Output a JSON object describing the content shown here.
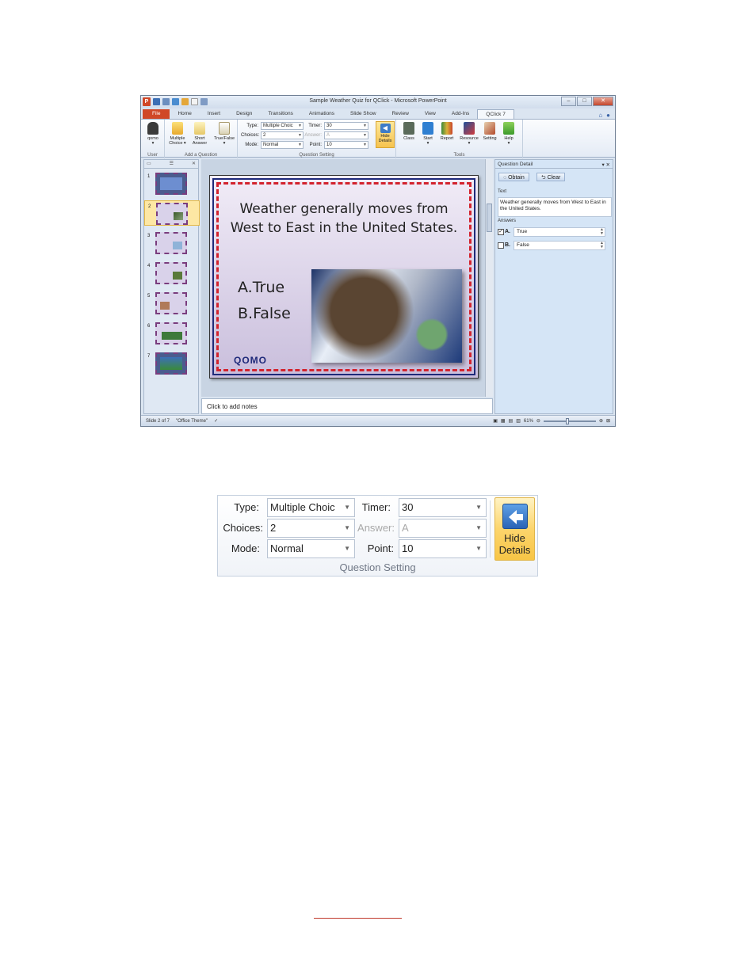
{
  "window": {
    "title": "Sample Weather Quiz for QClick - Microsoft PowerPoint",
    "logo_letter": "P",
    "controls": [
      "–",
      "□",
      "✕"
    ]
  },
  "tabs": [
    "File",
    "Home",
    "Insert",
    "Design",
    "Transitions",
    "Animations",
    "Slide Show",
    "Review",
    "View",
    "Add-Ins",
    "QClick 7"
  ],
  "active_tab": "QClick 7",
  "ribbon": {
    "user_group": {
      "label": "User",
      "button": "qomo"
    },
    "add_question_group": {
      "label": "Add a Question",
      "buttons": [
        {
          "line1": "Multiple",
          "line2": "Choice ▾"
        },
        {
          "line1": "Short",
          "line2": "Answer"
        },
        {
          "line1": "True/False",
          "line2": "▾"
        }
      ]
    },
    "question_setting_group": {
      "label": "Question Setting",
      "type_label": "Type:",
      "type_value": "Multiple Choic",
      "choices_label": "Choices:",
      "choices_value": "2",
      "mode_label": "Mode:",
      "mode_value": "Normal",
      "timer_label": "Timer:",
      "timer_value": "30",
      "answer_label": "Answer:",
      "answer_value": "A",
      "point_label": "Point:",
      "point_value": "10",
      "hide_line1": "Hide",
      "hide_line2": "Details"
    },
    "tools_group": {
      "label": "Tools",
      "buttons": [
        "Class",
        "Start",
        "Report",
        "Resource",
        "Setting",
        "Help"
      ]
    }
  },
  "slides": {
    "numbers": [
      "1",
      "2",
      "3",
      "4",
      "5",
      "6",
      "7"
    ],
    "selected": "2"
  },
  "slide": {
    "question_line1": "Weather generally moves from",
    "question_line2": "West to East in the United States.",
    "choice_a": "A.True",
    "choice_b": "B.False",
    "logo": "QOMO"
  },
  "notes": {
    "placeholder": "Click to add notes"
  },
  "question_detail": {
    "title": "Question Detail",
    "obtain": "Obtain",
    "clear": "Clear",
    "text_label": "Text",
    "text_value": "Weather generally moves from West to East in the United States.",
    "answers_label": "Answers",
    "answers": [
      {
        "letter": "A.",
        "value": "True",
        "checked": true
      },
      {
        "letter": "B.",
        "value": "False",
        "checked": false
      }
    ]
  },
  "status": {
    "slide_info": "Slide 2 of 7",
    "theme": "\"Office Theme\"",
    "zoom": "61%"
  },
  "zoom_panel": {
    "type_label": "Type:",
    "type_value": "Multiple Choic",
    "choices_label": "Choices:",
    "choices_value": "2",
    "mode_label": "Mode:",
    "mode_value": "Normal",
    "timer_label": "Timer:",
    "timer_value": "30",
    "answer_label": "Answer:",
    "answer_value": "A",
    "point_label": "Point:",
    "point_value": "10",
    "hide_line1": "Hide",
    "hide_line2": "Details",
    "group_label": "Question Setting"
  },
  "colors": {
    "accent": "#d04727",
    "selection": "#fde7a4",
    "link": "#c0392b"
  }
}
